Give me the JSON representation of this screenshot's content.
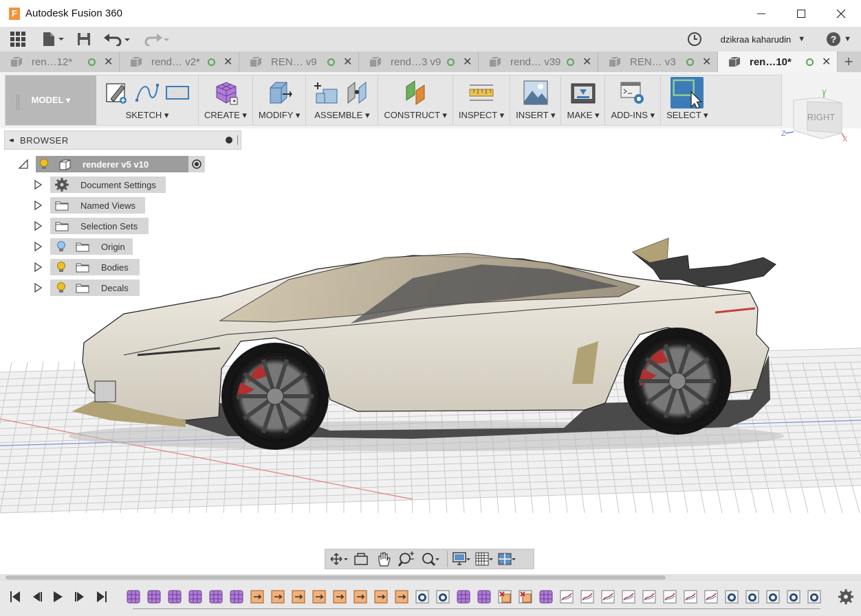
{
  "window": {
    "app_logo": "F",
    "title": "Autodesk Fusion 360",
    "minimize_icon": "minimize-icon",
    "maximize_icon": "maximize-icon",
    "close_icon": "close-icon"
  },
  "toolbar": {
    "user_name": "dzikraa kaharudin",
    "user_chevron": "▼",
    "help_chevron": "▼"
  },
  "tabs": [
    {
      "label": "ren…12*",
      "active": false
    },
    {
      "label": "rend… v2*",
      "active": false
    },
    {
      "label": "REN… v9",
      "active": false
    },
    {
      "label": "rend…3 v9",
      "active": false
    },
    {
      "label": "rend… v39",
      "active": false
    },
    {
      "label": "REN… v3",
      "active": false
    },
    {
      "label": "ren…10*",
      "active": true
    }
  ],
  "tab_close": "✕",
  "tab_add": "+",
  "ribbon": {
    "workspace": "MODEL ▾",
    "groups": [
      {
        "key": "sketch",
        "label": "SKETCH ▾"
      },
      {
        "key": "create",
        "label": "CREATE ▾"
      },
      {
        "key": "modify",
        "label": "MODIFY ▾"
      },
      {
        "key": "assemble",
        "label": "ASSEMBLE ▾"
      },
      {
        "key": "construct",
        "label": "CONSTRUCT ▾"
      },
      {
        "key": "inspect",
        "label": "INSPECT ▾"
      },
      {
        "key": "insert",
        "label": "INSERT ▾"
      },
      {
        "key": "make",
        "label": "MAKE ▾"
      },
      {
        "key": "addins",
        "label": "ADD-INS ▾"
      },
      {
        "key": "select",
        "label": "SELECT ▾"
      }
    ]
  },
  "viewcube": {
    "face": "RIGHT",
    "axis_y": "Y",
    "axis_z": "Z",
    "axis_x": "X"
  },
  "browser": {
    "collapse": "◂◂",
    "title": "BROWSER",
    "root": "renderer v5 v10",
    "items": [
      "Document Settings",
      "Named Views",
      "Selection Sets",
      "Origin",
      "Bodies",
      "Decals"
    ]
  },
  "colors": {
    "accent": "#3d7bb8",
    "ribbon_bg": "#e6e6e6",
    "tab_bg": "#cfcfcf",
    "car_body": "#e8e3d8",
    "car_lower": "#4a4a4a",
    "brake": "#b03030"
  }
}
